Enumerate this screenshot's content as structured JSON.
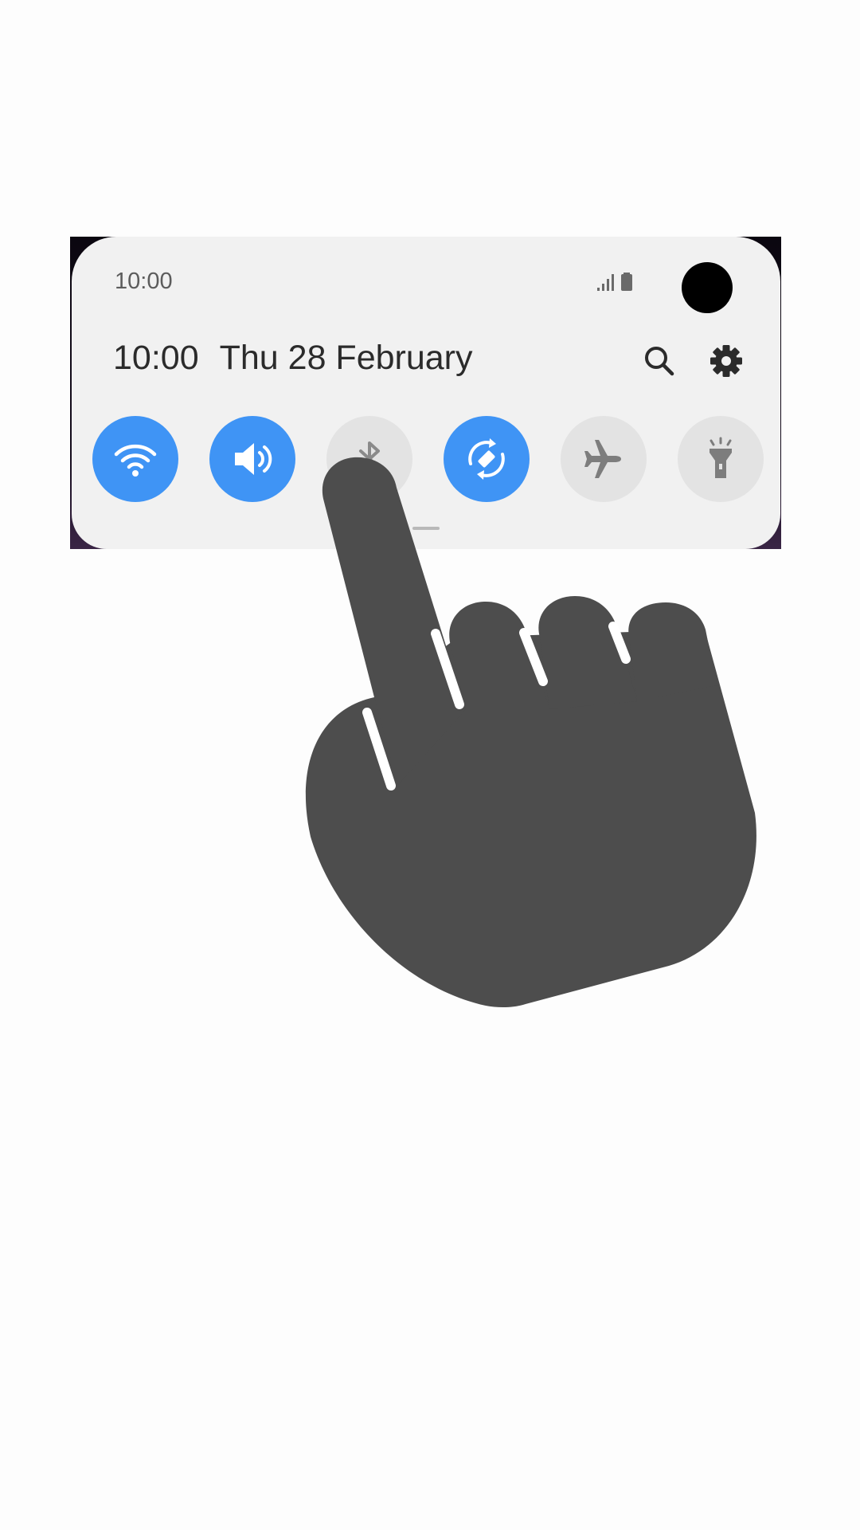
{
  "status_bar": {
    "time": "10:00",
    "signal_icon": "signal-bars-icon",
    "battery_icon": "battery-icon"
  },
  "header": {
    "time": "10:00",
    "date": "Thu 28 February",
    "search_icon": "search-icon",
    "settings_icon": "gear-icon"
  },
  "quick_settings": [
    {
      "name": "wifi",
      "icon": "wifi-icon",
      "state": "on"
    },
    {
      "name": "sound",
      "icon": "speaker-icon",
      "state": "on"
    },
    {
      "name": "bluetooth",
      "icon": "bluetooth-icon",
      "state": "off"
    },
    {
      "name": "auto-rotate",
      "icon": "rotate-icon",
      "state": "on"
    },
    {
      "name": "airplane-mode",
      "icon": "airplane-icon",
      "state": "off"
    },
    {
      "name": "flashlight",
      "icon": "flashlight-icon",
      "state": "off"
    }
  ],
  "colors": {
    "panel": "#f1f1f1",
    "tile_on": "#3f94f5",
    "tile_off": "#e3e3e3",
    "icon_off": "#7d7d7d",
    "hand": "#4d4d4d"
  },
  "overlay": {
    "hand_icon": "tapping-hand-icon",
    "target": "bluetooth"
  }
}
